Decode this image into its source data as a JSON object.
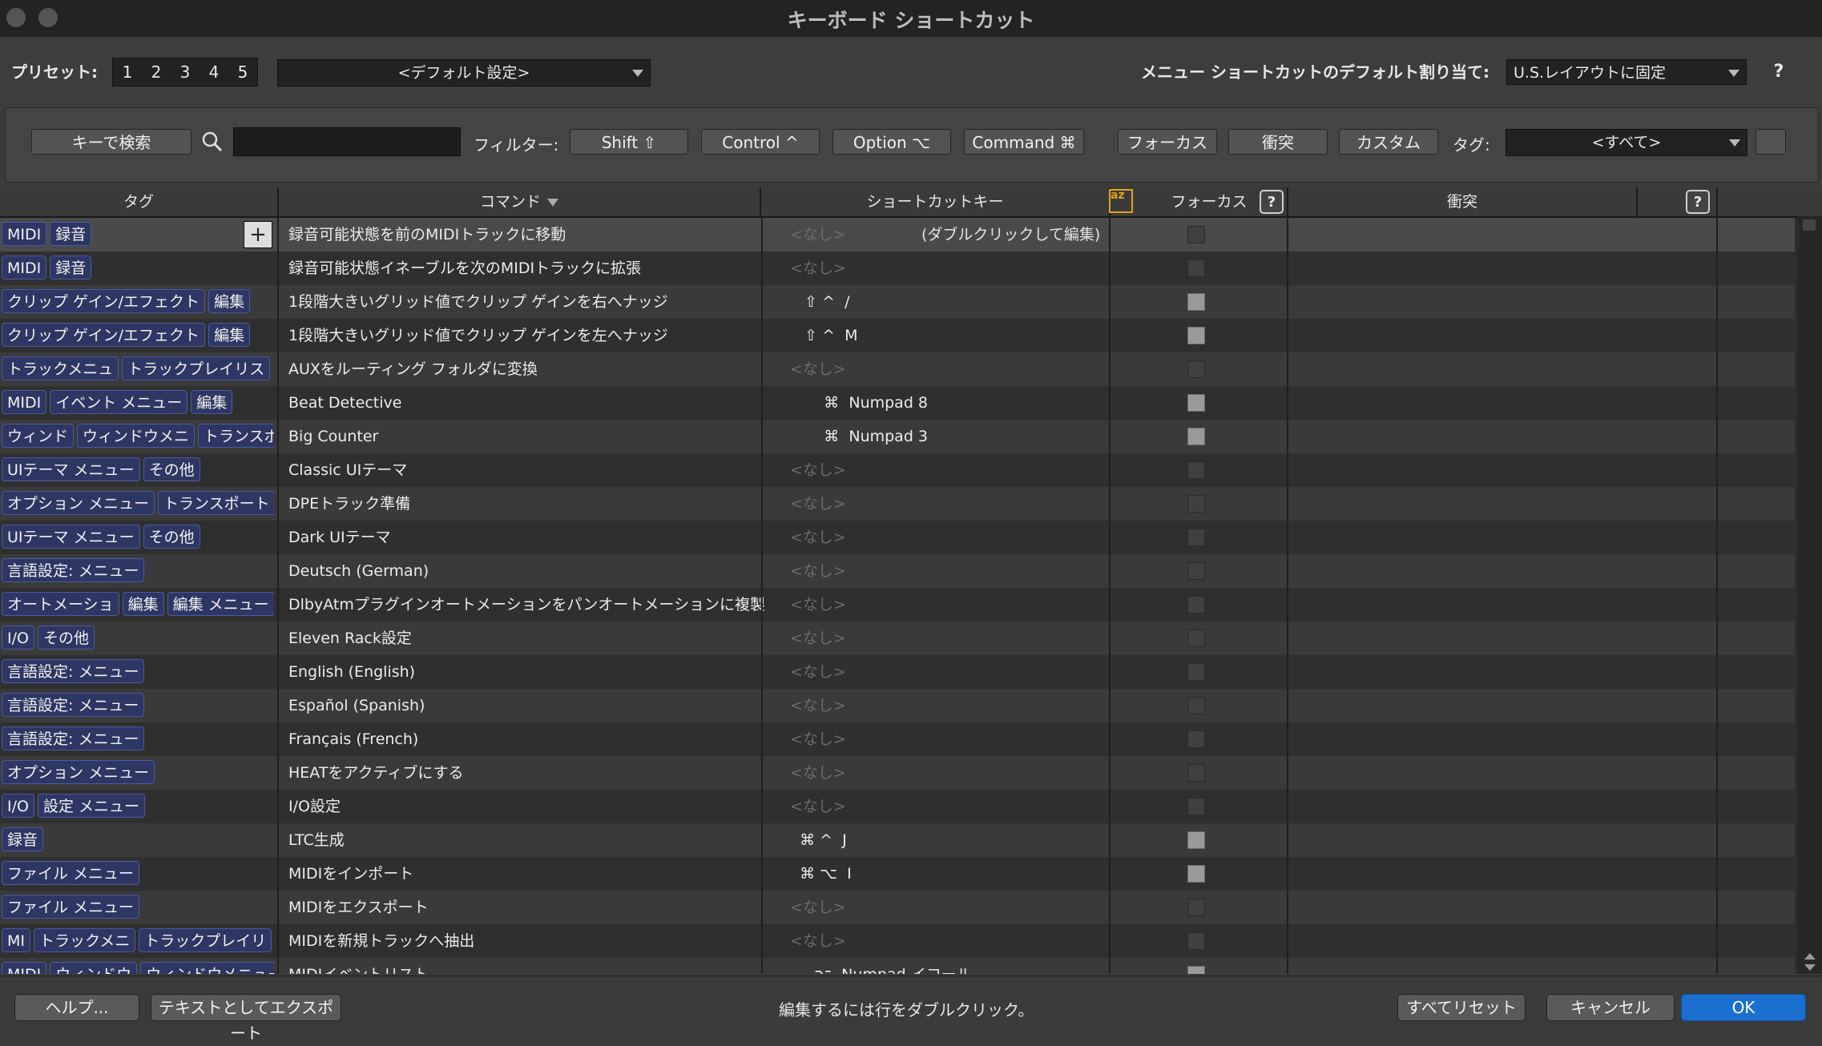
{
  "window": {
    "title": "キーボード ショートカット"
  },
  "preset": {
    "label": "プリセット:",
    "numbers": [
      "1",
      "2",
      "3",
      "4",
      "5"
    ],
    "value": "<デフォルト設定>"
  },
  "menu_default": {
    "label": "メニュー ショートカットのデフォルト割り当て:",
    "value": "U.S.レイアウトに固定",
    "help": "?"
  },
  "filterbar": {
    "search_button": "キーで検索",
    "filter_label": "フィルター:",
    "shift": "Shift ⇧",
    "control": "Control ^",
    "option": "Option ⌥",
    "command": "Command ⌘",
    "focus": "フォーカス",
    "conflict": "衝突",
    "custom": "カスタム",
    "tag_label": "タグ:",
    "tag_value": "<すべて>"
  },
  "columns": {
    "tag": "タグ",
    "command": "コマンド",
    "shortcut": "ショートカットキー",
    "focus": "フォーカス",
    "conflict": "衝突",
    "az_icon": "az",
    "help": "?"
  },
  "rows": [
    {
      "tags": [
        "MIDI",
        "録音"
      ],
      "command": "録音可能状態を前のMIDIトラックに移動",
      "key": "<なし>",
      "none": true,
      "checked": false,
      "selected": true,
      "hint": "(ダブルクリックして編集)"
    },
    {
      "tags": [
        "MIDI",
        "録音"
      ],
      "command": "録音可能状態イネーブルを次のMIDIトラックに拡張",
      "key": "<なし>",
      "none": true,
      "checked": false
    },
    {
      "tags": [
        "クリップ ゲイン/エフェクト",
        "編集"
      ],
      "command": "1段階大きいグリッド値でクリップ ゲインを右へナッジ",
      "key": "   ⇧ ^  /",
      "none": false,
      "checked": true
    },
    {
      "tags": [
        "クリップ ゲイン/エフェクト",
        "編集"
      ],
      "command": "1段階大きいグリッド値でクリップ ゲインを左へナッジ",
      "key": "   ⇧ ^  M",
      "none": false,
      "checked": true
    },
    {
      "tags": [
        "トラックメニュ",
        "トラックプレイリス"
      ],
      "command": "AUXをルーティング フォルダに変換",
      "key": "<なし>",
      "none": true,
      "checked": false
    },
    {
      "tags": [
        "MIDI",
        "イベント メニュー",
        "編集"
      ],
      "command": "Beat Detective",
      "key": "       ⌘  Numpad 8",
      "none": false,
      "checked": true
    },
    {
      "tags": [
        "ウィンド",
        "ウィンドウメニ",
        "トランスポ"
      ],
      "command": "Big Counter",
      "key": "       ⌘  Numpad 3",
      "none": false,
      "checked": true
    },
    {
      "tags": [
        "UIテーマ メニュー",
        "その他"
      ],
      "command": "Classic UIテーマ",
      "key": "<なし>",
      "none": true,
      "checked": false
    },
    {
      "tags": [
        "オプション メニュー",
        "トランスポート"
      ],
      "command": "DPEトラック準備",
      "key": "<なし>",
      "none": true,
      "checked": false
    },
    {
      "tags": [
        "UIテーマ メニュー",
        "その他"
      ],
      "command": "Dark UIテーマ",
      "key": "<なし>",
      "none": true,
      "checked": false
    },
    {
      "tags": [
        "言語設定: メニュー"
      ],
      "command": "Deutsch (German)",
      "key": "<なし>",
      "none": true,
      "checked": false
    },
    {
      "tags": [
        "オートメーショ",
        "編集",
        "編集 メニュー"
      ],
      "command": "DlbyAtmプラグインオートメーションをパンオートメーションに複製",
      "key": "<なし>",
      "none": true,
      "checked": false
    },
    {
      "tags": [
        "I/O",
        "その他"
      ],
      "command": "Eleven Rack設定",
      "key": "<なし>",
      "none": true,
      "checked": false
    },
    {
      "tags": [
        "言語設定: メニュー"
      ],
      "command": "English (English)",
      "key": "<なし>",
      "none": true,
      "checked": false
    },
    {
      "tags": [
        "言語設定: メニュー"
      ],
      "command": "Español (Spanish)",
      "key": "<なし>",
      "none": true,
      "checked": false
    },
    {
      "tags": [
        "言語設定: メニュー"
      ],
      "command": "Français (French)",
      "key": "<なし>",
      "none": true,
      "checked": false
    },
    {
      "tags": [
        "オプション メニュー"
      ],
      "command": "HEATをアクティブにする",
      "key": "<なし>",
      "none": true,
      "checked": false
    },
    {
      "tags": [
        "I/O",
        "設定 メニュー"
      ],
      "command": "I/O設定",
      "key": "<なし>",
      "none": true,
      "checked": false
    },
    {
      "tags": [
        "録音"
      ],
      "command": "LTC生成",
      "key": "  ⌘ ^  J",
      "none": false,
      "checked": true
    },
    {
      "tags": [
        "ファイル メニュー"
      ],
      "command": "MIDIをインポート",
      "key": "  ⌘ ⌥  I",
      "none": false,
      "checked": true
    },
    {
      "tags": [
        "ファイル メニュー"
      ],
      "command": "MIDIをエクスポート",
      "key": "<なし>",
      "none": true,
      "checked": false
    },
    {
      "tags": [
        "MI",
        "トラックメニ",
        "トラックプレイリ"
      ],
      "command": "MIDIを新規トラックへ抽出",
      "key": "<なし>",
      "none": true,
      "checked": false
    },
    {
      "tags": [
        "MIDI",
        "ウィンドウ",
        "ウィンドウメニュー"
      ],
      "command": "MIDIイベントリスト",
      "key": "     ⌥  Numpad イコール",
      "none": false,
      "checked": true
    }
  ],
  "footer": {
    "help": "ヘルプ...",
    "export": "テキストとしてエクスポート",
    "status": "編集するには行をダブルクリック。",
    "reset_all": "すべてリセット",
    "cancel": "キャンセル",
    "ok": "OK"
  }
}
